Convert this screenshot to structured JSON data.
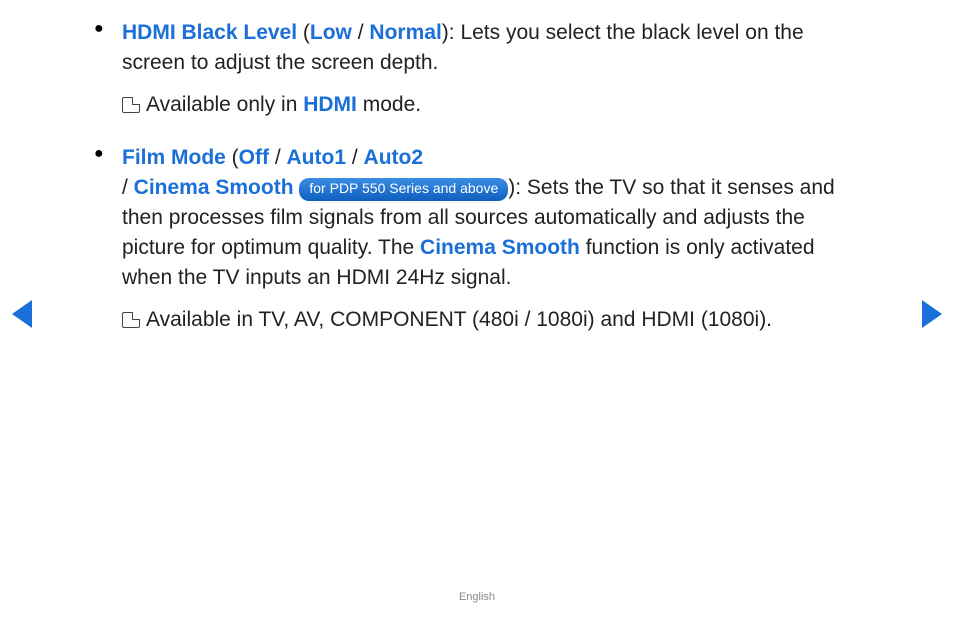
{
  "items": [
    {
      "term": "HDMI Black Level",
      "options": [
        "Low",
        "Normal"
      ],
      "close_paren": ")",
      "desc": ": Lets you select the black level on the screen to adjust the screen depth.",
      "note_pre": "Available only in ",
      "note_term": "HDMI",
      "note_post": " mode."
    },
    {
      "term": "Film Mode",
      "options": [
        "Off",
        "Auto1",
        "Auto2"
      ],
      "line2_sep": " / ",
      "line2_term": "Cinema Smooth",
      "badge": "for PDP 550 Series and above",
      "close_paren": ")",
      "desc1": ": Sets the TV so that it senses and then processes film signals from all sources automatically and adjusts the picture for optimum quality. The ",
      "desc_term": "Cinema Smooth",
      "desc2": " function is only activated when the TV inputs an HDMI 24Hz signal.",
      "note_full": "Available in TV, AV, COMPONENT (480i / 1080i) and HDMI (1080i)."
    }
  ],
  "open_paren": " (",
  "opt_sep": " / ",
  "footer": "English"
}
